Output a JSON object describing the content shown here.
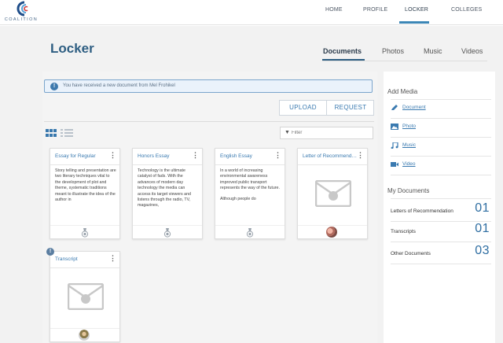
{
  "app": {
    "logo_text": "COALITION"
  },
  "nav": {
    "items": [
      "HOME",
      "PROFILE",
      "LOCKER",
      "COLLEGES"
    ],
    "active": "LOCKER"
  },
  "page": {
    "title": "Locker"
  },
  "tabs": {
    "items": [
      "Documents",
      "Photos",
      "Music",
      "Videos"
    ],
    "active": "Documents"
  },
  "alert": {
    "text": "You have received a new document from Mel Frohikel"
  },
  "actions": {
    "upload": "UPLOAD",
    "request": "REQUEST"
  },
  "filter": {
    "placeholder": "Filter"
  },
  "cards": [
    {
      "title": "Essay for Regular",
      "body": [
        "Story telling and presentation are two literary techniques vital to the development of plot and theme, systematic traditions meant to illustrate the idea of the author in"
      ],
      "footer_icon": "medal-icon"
    },
    {
      "title": "Honors Essay",
      "body": [
        "Technology is the ultimate catalyst of fads. With the advances of modern day technology the media can access its target viewers and listens through the radio, TV, magazines,"
      ],
      "footer_icon": "medal-icon"
    },
    {
      "title": "English Essay",
      "body": [
        "In a world of increasing environmental awareness improved public transport represents the way of the future.",
        "Although people do"
      ],
      "footer_icon": "medal-icon"
    },
    {
      "title": "Letter of Recommendation",
      "body": [],
      "footer_icon": "avatar"
    },
    {
      "title": "Transcript",
      "body": [],
      "footer_icon": "avatar",
      "badge": "!"
    }
  ],
  "sidebar": {
    "add_media_title": "Add Media",
    "media": [
      {
        "label": "Document",
        "icon": "pencil-icon"
      },
      {
        "label": "Photo",
        "icon": "photo-icon"
      },
      {
        "label": "Music",
        "icon": "music-note-icon"
      },
      {
        "label": "Video",
        "icon": "video-camera-icon"
      }
    ],
    "my_docs_title": "My Documents",
    "docs": [
      {
        "label": "Letters of Recommendation",
        "count": "01"
      },
      {
        "label": "Transcripts",
        "count": "01"
      },
      {
        "label": "Other Documents",
        "count": "03"
      }
    ]
  },
  "colors": {
    "accent": "#2e5e82",
    "link": "#3a7ab0",
    "alert_bg": "#eaf2fb"
  }
}
